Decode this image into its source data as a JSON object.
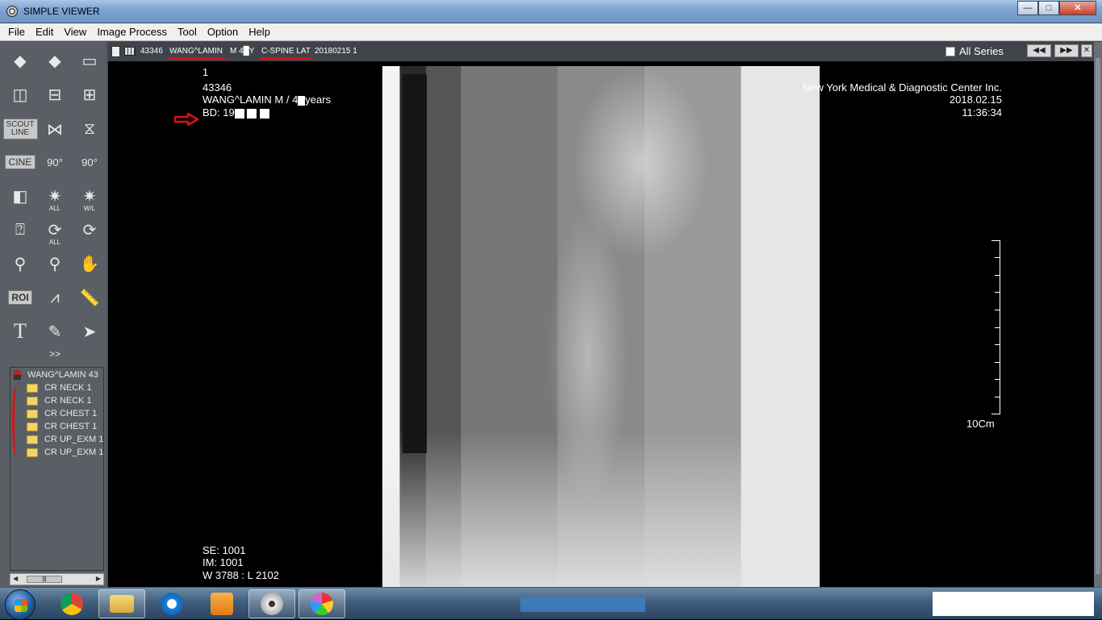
{
  "window": {
    "title": "SIMPLE VIEWER",
    "buttons": {
      "minimize": "—",
      "maximize": "□",
      "close": "✕"
    }
  },
  "menu": [
    "File",
    "Edit",
    "View",
    "Image Process",
    "Tool",
    "Option",
    "Help"
  ],
  "tools": {
    "scout_line": "SCOUT\nLINE",
    "cine": "CINE",
    "rot90_a": "90°",
    "rot90_b": "90°",
    "all_1": "ALL",
    "wl": "W/L",
    "all_2": "ALL",
    "roi": "ROI",
    "text_tool": "T",
    "more": ">>"
  },
  "tree": {
    "patient": "WANG^LAMIN 43",
    "items": [
      "CR NECK  1",
      "CR NECK  1",
      "CR CHEST  1",
      "CR CHEST  1",
      "CR UP_EXM  1",
      "CR UP_EXM  1"
    ]
  },
  "viewer_header": {
    "id": "43346",
    "patient": "WANG^LAMIN",
    "sex_age": "M  4█Y",
    "study": "C-SPINE LAT",
    "date_num": "20180215  1",
    "all_series": "All Series",
    "prev": "◀◀",
    "next": "▶▶",
    "close": "✕"
  },
  "overlay": {
    "image_no": "1",
    "patient_id": "43346",
    "patient_line_a": "WANG^LAMIN M / 4",
    "patient_line_b": "years",
    "bd_prefix": "BD: 19",
    "institution": "New York Medical & Diagnostic Center Inc.",
    "date": "2018.02.15",
    "time": "11:36:34",
    "se": "SE: 1001",
    "im": "IM: 1001",
    "wl": "W 3788 : L 2102",
    "scale": "10Cm"
  },
  "taskbar": {
    "apps": [
      "chrome",
      "explorer",
      "internet-explorer",
      "media-player",
      "disc-viewer",
      "paint"
    ]
  },
  "colors": {
    "annotation_red": "#d11111",
    "viewer_bg": "#000000",
    "toolbox_bg": "#5a5f66"
  }
}
